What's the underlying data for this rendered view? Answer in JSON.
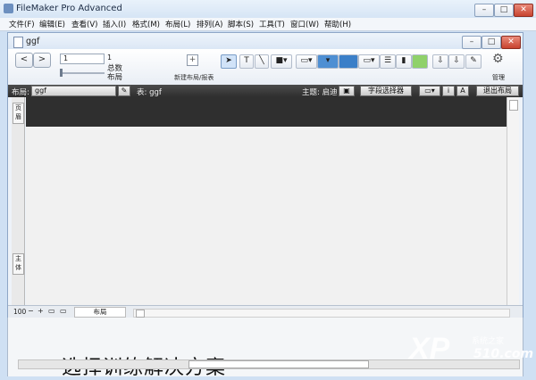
{
  "app": {
    "title": "FileMaker Pro Advanced"
  },
  "window_controls": {
    "minimize": "–",
    "maximize": "□",
    "close": "✕"
  },
  "menubar": [
    "文件(F)",
    "编辑(E)",
    "查看(V)",
    "插入(I)",
    "格式(M)",
    "布局(L)",
    "排列(A)",
    "脚本(S)",
    "工具(T)",
    "窗口(W)",
    "帮助(H)"
  ],
  "document": {
    "title": "ggf"
  },
  "toolbar": {
    "back_label": "<",
    "forward_label": ">",
    "record_value": "1",
    "record_count": "1",
    "total_label": "总数",
    "layout_label": "布局",
    "new_layout_label": "新建布局/报表",
    "manage_label": "管理"
  },
  "layoutbar": {
    "layout_prefix": "布局:",
    "layout_value": "ggf",
    "table_label": "表: ggf",
    "theme_label": "主题: 启迪",
    "field_picker_label": "字段选择器",
    "exit_layout_label": "退出布局"
  },
  "parts": {
    "header_label": "页眉",
    "body_label": "主体"
  },
  "statusbar": {
    "zoom": "100",
    "mode": "布局"
  },
  "underdoc": {
    "text": "选择训练解决方案"
  },
  "watermark": {
    "logo": "XP",
    "sub": "系统之家",
    "num": "510.com"
  }
}
